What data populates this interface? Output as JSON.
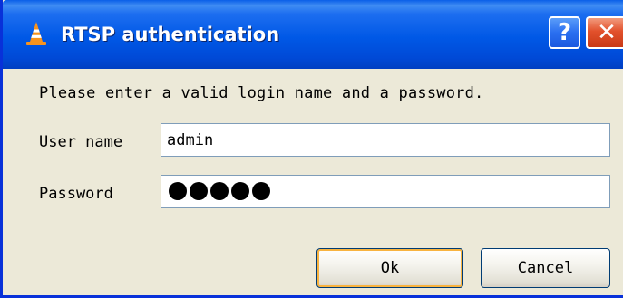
{
  "window": {
    "title": "RTSP authentication",
    "icon": "vlc-cone-icon",
    "help_label": "?",
    "close_label": "✕"
  },
  "prompt": "Please enter a valid login name and a password.",
  "fields": {
    "username": {
      "label": "User name",
      "value": "admin"
    },
    "password": {
      "label": "Password",
      "masked_length": 5
    }
  },
  "buttons": {
    "ok": {
      "mnemonic": "O",
      "rest": "k"
    },
    "cancel": {
      "mnemonic": "C",
      "rest": "ancel"
    }
  },
  "colors": {
    "titlebar": "#0058e6",
    "close": "#e2512c",
    "dialog_bg": "#ece9d8",
    "focus": "#f8b33f"
  }
}
